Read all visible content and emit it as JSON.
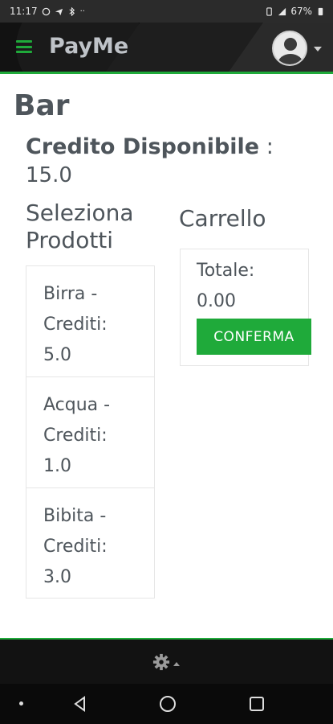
{
  "status_bar": {
    "time": "11:17",
    "battery": "67%",
    "icons": [
      "whatsapp-icon",
      "telegram-icon",
      "bluetooth-icon",
      "signal-icon",
      "battery-icon"
    ]
  },
  "navbar": {
    "brand": "PayMe",
    "accent_color": "#1faa3a"
  },
  "main": {
    "page_title": "Bar",
    "credit_label": "Credito Disponibile",
    "credit_separator": " :",
    "credit_value": "15.0",
    "products_title": "Seleziona Prodotti",
    "products": [
      {
        "name": "Birra -",
        "credits_label": "Crediti:",
        "credits": "5.0"
      },
      {
        "name": "Acqua -",
        "credits_label": "Crediti:",
        "credits": "1.0"
      },
      {
        "name": "Bibita -",
        "credits_label": "Crediti:",
        "credits": "3.0"
      }
    ],
    "cart": {
      "title": "Carrello",
      "total_label": "Totale:",
      "total_value": "0.00",
      "confirm_label": "CONFERMA"
    }
  },
  "footer": {
    "icon": "gear-icon"
  }
}
